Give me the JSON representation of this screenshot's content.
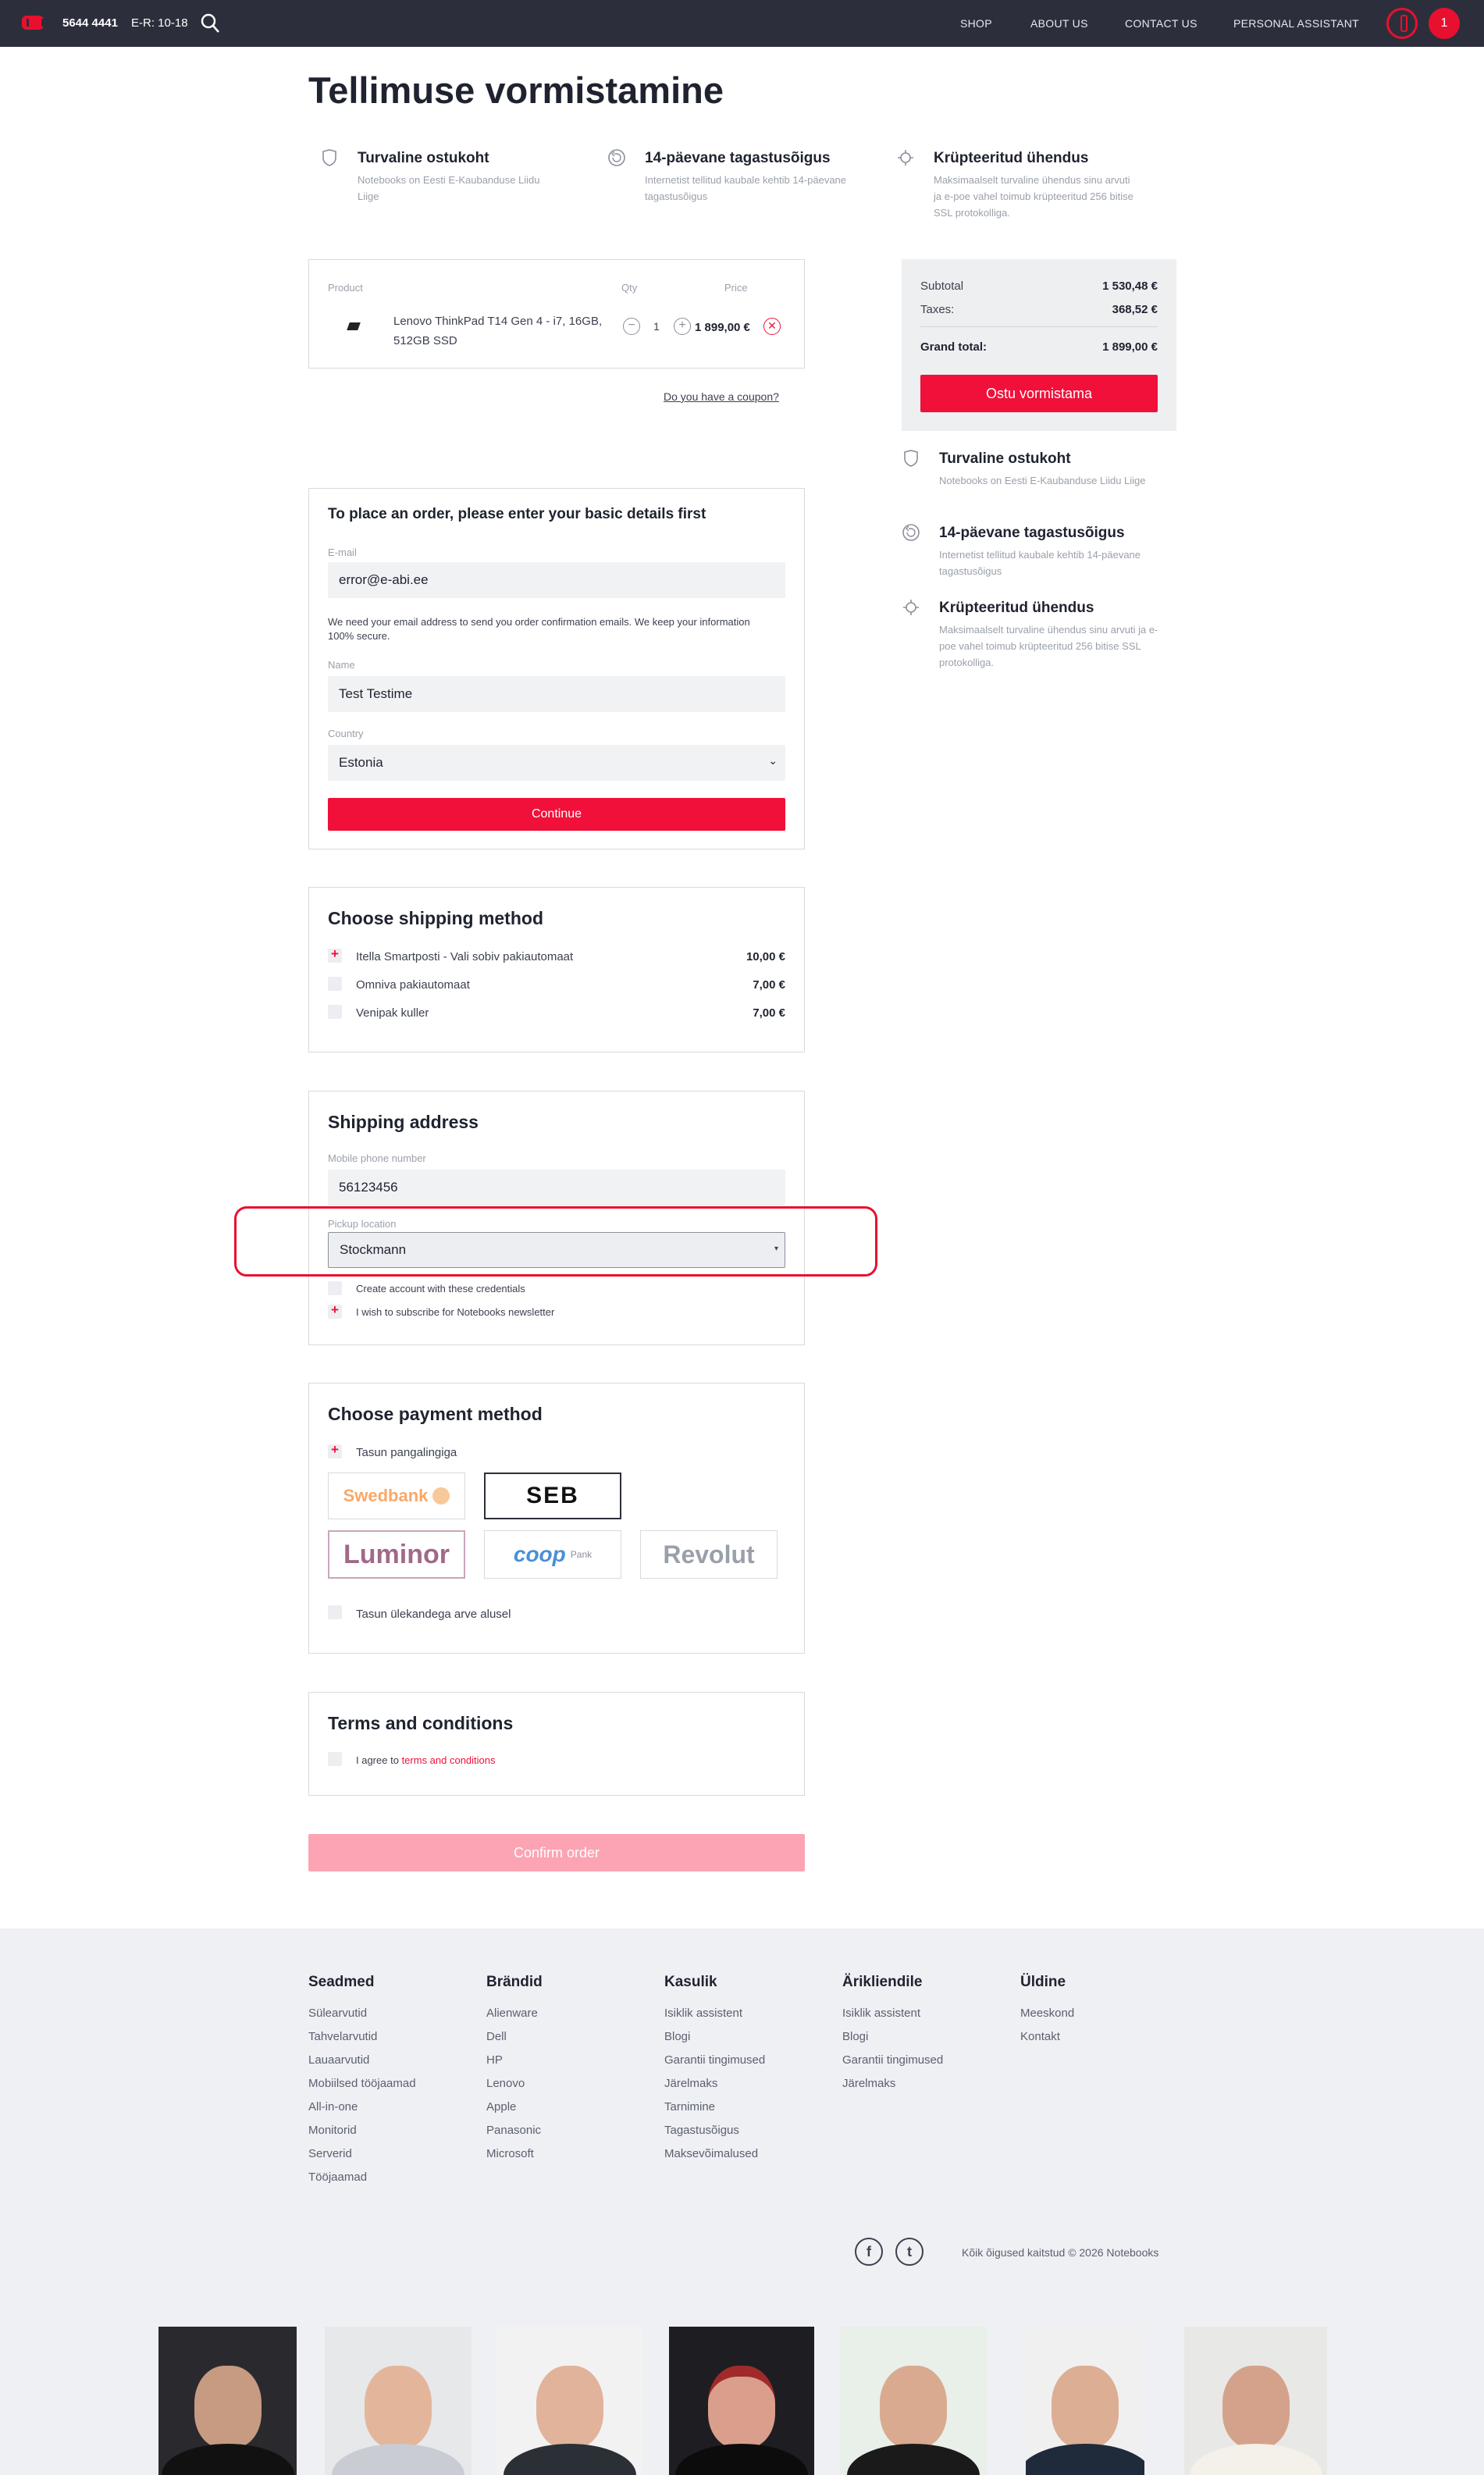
{
  "header": {
    "phone": "5644 4441",
    "hours": "E-R: 10-18",
    "nav": [
      "SHOP",
      "ABOUT US",
      "CONTACT US",
      "PERSONAL ASSISTANT"
    ],
    "cart_count": "1"
  },
  "page": {
    "title": "Tellimuse vormistamine"
  },
  "features": [
    {
      "icon": "shield-icon",
      "title": "Turvaline ostukoht",
      "desc": "Notebooks on Eesti E-Kaubanduse Liidu Liige"
    },
    {
      "icon": "return-icon",
      "title": "14-päevane tagastusõigus",
      "desc": "Internetist tellitud kaubale kehtib 14-päevane tagastusõigus"
    },
    {
      "icon": "encryption-icon",
      "title": "Krüpteeritud ühendus",
      "desc": "Maksimaalselt turvaline ühendus sinu arvuti ja e-poe vahel toimub krüpteeritud 256 bitise SSL protokolliga."
    }
  ],
  "product_table": {
    "headers": {
      "product": "Product",
      "qty": "Qty",
      "price": "Price"
    },
    "item": {
      "name": "Lenovo ThinkPad T14 Gen 4 - i7, 16GB, 512GB SSD",
      "qty": "1",
      "price": "1 899,00 €"
    },
    "coupon": "Do you have a coupon?"
  },
  "summary": {
    "subtotal_label": "Subtotal",
    "subtotal": "1 530,48 €",
    "taxes_label": "Taxes:",
    "taxes": "368,52 €",
    "grand_label": "Grand total:",
    "grand": "1 899,00 €",
    "checkout": "Ostu vormistama"
  },
  "details": {
    "title": "To place an order, please enter your basic details first",
    "email_label": "E-mail",
    "email": "error@e-abi.ee",
    "email_note": "We need your email address to send you order confirmation emails. We keep your information 100% secure.",
    "name_label": "Name",
    "name": "Test Testime",
    "country_label": "Country",
    "country": "Estonia",
    "continue": "Continue"
  },
  "shipping": {
    "title": "Choose shipping method",
    "options": [
      {
        "label": "Itella Smartposti - Vali sobiv pakiautomaat",
        "price": "10,00 €",
        "checked": true
      },
      {
        "label": "Omniva pakiautomaat",
        "price": "7,00 €",
        "checked": false
      },
      {
        "label": "Venipak kuller",
        "price": "7,00 €",
        "checked": false
      }
    ]
  },
  "address": {
    "title": "Shipping address",
    "phone_label": "Mobile phone number",
    "phone": "56123456",
    "pickup_label": "Pickup location",
    "pickup": "Stockmann",
    "create_account": "Create account with these credentials",
    "newsletter": "I wish to subscribe for Notebooks newsletter"
  },
  "payment": {
    "title": "Choose payment method",
    "bank_link": "Tasun pangalingiga",
    "banks": [
      "Swedbank",
      "SEB",
      "Luminor",
      "coop",
      "Pank",
      "Revolut"
    ],
    "invoice": "Tasun ülekandega arve alusel"
  },
  "terms": {
    "title": "Terms and conditions",
    "agree": "I agree to",
    "link": "terms and conditions"
  },
  "confirm": "Confirm order",
  "footer": {
    "columns": [
      {
        "title": "Seadmed",
        "links": [
          "Sülearvutid",
          "Tahvelarvutid",
          "Lauaarvutid",
          "Mobiilsed tööjaamad",
          "All-in-one",
          "Monitorid",
          "Serverid",
          "Tööjaamad"
        ]
      },
      {
        "title": "Brändid",
        "links": [
          "Alienware",
          "Dell",
          "HP",
          "Lenovo",
          "Apple",
          "Panasonic",
          "Microsoft"
        ]
      },
      {
        "title": "Kasulik",
        "links": [
          "Isiklik assistent",
          "Blogi",
          "Garantii tingimused",
          "Järelmaks",
          "Tarnimine",
          "Tagastusõigus",
          "Maksevõimalused"
        ]
      },
      {
        "title": "Ärikliendile",
        "links": [
          "Isiklik assistent",
          "Blogi",
          "Garantii tingimused",
          "Järelmaks"
        ]
      },
      {
        "title": "Üldine",
        "links": [
          "Meeskond",
          "Kontakt"
        ]
      }
    ],
    "copyright": "Kõik õigused kaitstud © 2026 Notebooks",
    "social": [
      "f",
      "t"
    ]
  },
  "colors": {
    "accent": "#f0103a",
    "header": "#2c2f3b",
    "annotation": "#e8102f"
  }
}
